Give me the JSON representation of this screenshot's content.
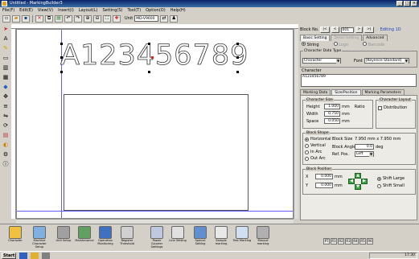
{
  "window": {
    "title": "Untitled - MarkingBuilder3",
    "min": "_",
    "max": "□",
    "close": "×"
  },
  "menu": [
    "File(F)",
    "Edit(E)",
    "View(V)",
    "Insert(I)",
    "Layout(L)",
    "Setting(S)",
    "Tool(T)",
    "Option(O)",
    "Help(H)"
  ],
  "toolbar": {
    "unit_label": "Unit",
    "unit_value": "MD-V9600"
  },
  "canvas": {
    "marking_text": "A123456789"
  },
  "panel": {
    "block_no_label": "Block No.",
    "block_no_value": "001",
    "editing_label": "Editing 1D",
    "tabs": [
      "Basic Setting",
      "Detail Setting",
      "Advanced"
    ],
    "mode_options": [
      "String",
      "Logo",
      "Barcode"
    ],
    "char_data_type_label": "Character Data Type",
    "char_data_type_value": "Character",
    "font_label": "Font",
    "font_value": "[Keyence Standard]",
    "character_label": "Character",
    "character_value": "A123456789",
    "subtabs": [
      "Marking Data",
      "Size/Position",
      "Marking Parameters"
    ],
    "char_size_label": "Character Size",
    "height_label": "Height",
    "height_value": "1.000",
    "width_label": "Width",
    "width_value": "0.750",
    "space_label": "Space",
    "space_value": "0.050",
    "unit_mm": "mm",
    "ratio_label": "Ratio",
    "char_layout_label": "Character Layout",
    "distribution_label": "Distribution",
    "block_shape_label": "Block Shape",
    "shape_options": [
      "Horizontal",
      "Vertical",
      "In Arc",
      "Out Arc"
    ],
    "block_size_label": "Block Size",
    "block_size_value": "7.950 mm x 7.950 mm",
    "block_angle_label": "Block Angle",
    "block_angle_value": "0.0",
    "block_angle_unit": "deg",
    "ref_pos_label": "Ref. Pos.",
    "ref_pos_value": "Left",
    "block_position_label": "Block Position",
    "x_label": "X",
    "x_value": "0.000",
    "y_label": "Y",
    "y_value": "0.000",
    "shift_options": [
      "Shift Large",
      "Shift Small"
    ]
  },
  "bottom_icons": [
    "Character",
    "Machine Character Setup",
    "Unit Setup",
    "Maintenance",
    "Operation Monitoring",
    "Register Threshold",
    "Power Counter Settings",
    "Line Setting",
    "Special Setting",
    "Sample marking",
    "Test Marking",
    "Manual marking"
  ],
  "bottom_right": [
    "PT",
    "R1",
    "R2",
    "R3",
    "R4",
    "R5",
    "R6"
  ],
  "taskbar": {
    "start": "Start",
    "clock": "17:30"
  }
}
